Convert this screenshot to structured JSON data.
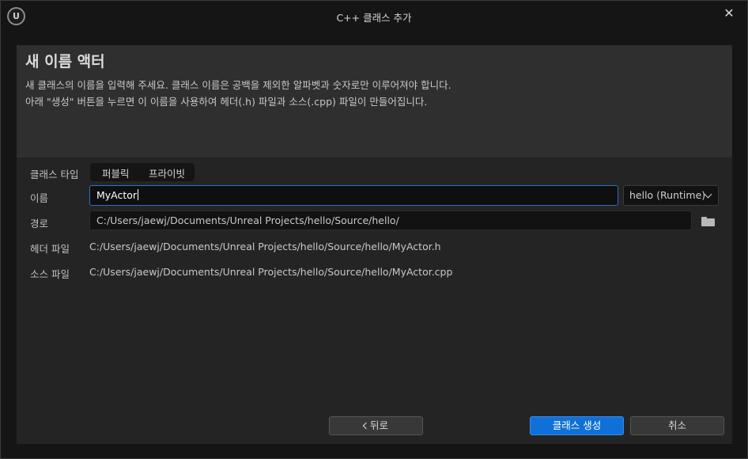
{
  "window": {
    "title": "C++ 클래스 추가",
    "logo_text": "U",
    "close_glyph": "✕",
    "icons": [
      "unreal-logo-icon",
      "close-icon",
      "folder-icon",
      "chevron-down-icon",
      "chevron-left-icon"
    ]
  },
  "header": {
    "title": "새 이름 액터",
    "description_line1": "새 클래스의 이름을 입력해 주세요. 클래스 이름은 공백을 제외한 알파벳과 숫자로만 이루어져야 합니다.",
    "description_line2": "아래 \"생성\" 버튼을 누르면 이 이름을 사용하여 헤더(.h) 파일과 소스(.cpp) 파일이 만들어집니다."
  },
  "form": {
    "class_type": {
      "label": "클래스 타입",
      "options": [
        "퍼블릭",
        "프라이빗"
      ]
    },
    "name": {
      "label": "이름",
      "value": "MyActor"
    },
    "module": {
      "selected": "hello (Runtime)"
    },
    "path": {
      "label": "경로",
      "value": "C:/Users/jaewj/Documents/Unreal Projects/hello/Source/hello/"
    },
    "header_file": {
      "label": "헤더 파일",
      "value": "C:/Users/jaewj/Documents/Unreal Projects/hello/Source/hello/MyActor.h"
    },
    "source_file": {
      "label": "소스 파일",
      "value": "C:/Users/jaewj/Documents/Unreal Projects/hello/Source/hello/MyActor.cpp"
    }
  },
  "buttons": {
    "back": "뒤로",
    "create": "클래스 생성",
    "cancel": "취소"
  },
  "colors": {
    "accent": "#0f70d7",
    "focus_border": "#2f6fc8",
    "background": "#151515",
    "panel": "#242424",
    "header_band": "#2f2f2f"
  }
}
